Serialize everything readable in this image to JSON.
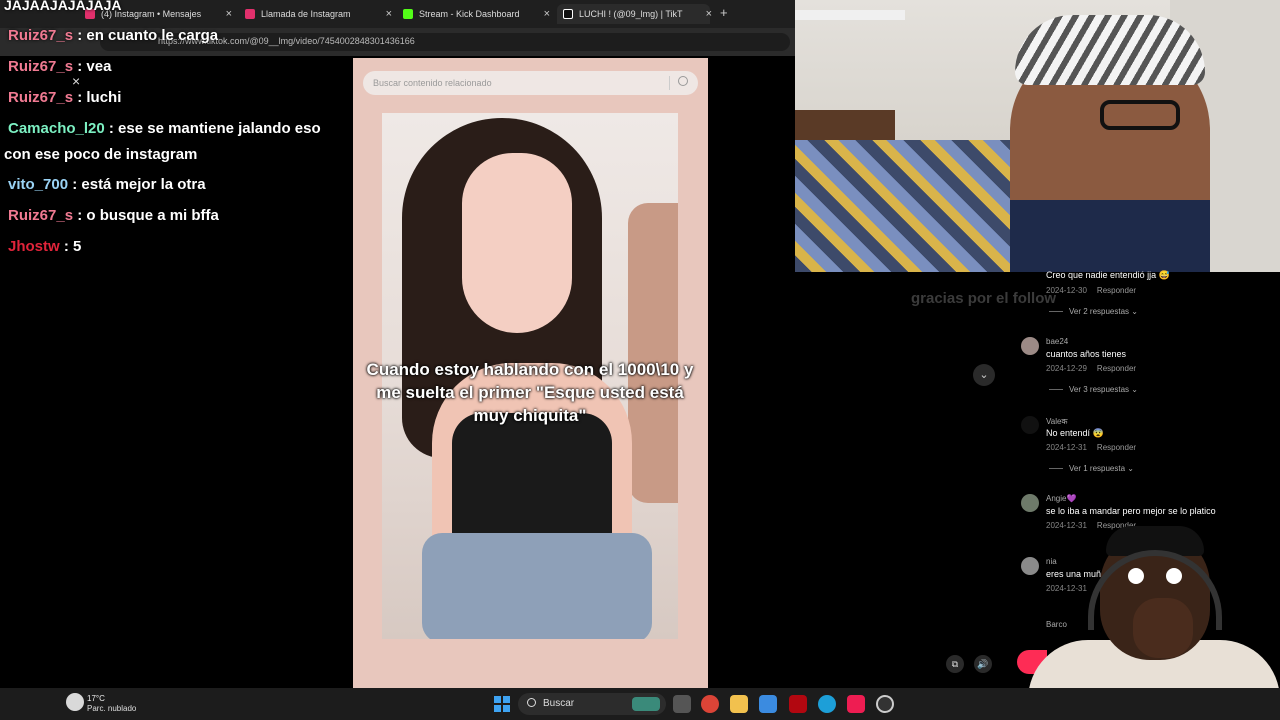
{
  "browser": {
    "tabs": [
      {
        "title": "(4) Instagram • Mensajes",
        "color": "#e1306c"
      },
      {
        "title": "Llamada de Instagram",
        "color": "#e1306c"
      },
      {
        "title": "Stream - Kick Dashboard",
        "color": "#53fc18"
      },
      {
        "title": "LUCHI ! (@09_lmg) | TikT",
        "color": "#ffffff"
      }
    ],
    "new_tab": "+",
    "url": "https://www.tiktok.com/@09__lmg/video/7454002848301436166"
  },
  "chat": {
    "top_message": "JAJAAJAJAJAJA",
    "close": "×",
    "messages": [
      {
        "user": "Ruiz67_s",
        "user_color": "#f07a92",
        "text": ": en cuanto le carga"
      },
      {
        "user": "Ruiz67_s",
        "user_color": "#f07a92",
        "text": ": vea"
      },
      {
        "user": "Ruiz67_s",
        "user_color": "#f07a92",
        "text": ": luchi"
      },
      {
        "user": "Camacho_l20",
        "user_color": "#7cf0c2",
        "text": ": ese se mantiene jalando eso con ese poco de instagram"
      },
      {
        "user": "vito_700",
        "user_color": "#9ad3f5",
        "text": ": está mejor la otra"
      },
      {
        "user": "Ruiz67_s",
        "user_color": "#f07a92",
        "text": ": o busque a mi bffa"
      },
      {
        "user": "Jhostw",
        "user_color": "#e0243a",
        "text": ": 5"
      }
    ]
  },
  "tiktok": {
    "search_placeholder": "Buscar contenido relacionado",
    "video_caption": "Cuando estoy hablando con el 1000\\10 y me suelta el primer \"Esque usted está muy chiquita\"",
    "overlay_text": "gracias por el follow",
    "comments": [
      {
        "name": "",
        "text": "Creo que nadie entendió jja 😅",
        "date": "2024-12-30",
        "reply": "Responder",
        "more": "Ver 2 respuestas"
      },
      {
        "name": "bae24",
        "text": "cuantos años tienes",
        "date": "2024-12-29",
        "reply": "Responder",
        "more": "Ver 3 respuestas"
      },
      {
        "name": "Valeक",
        "text": "No entendí 😨",
        "date": "2024-12-31",
        "reply": "Responder",
        "more": "Ver 1 respuesta"
      },
      {
        "name": "Angie💜",
        "text": "se lo iba a mandar pero mejor se lo platico",
        "date": "2024-12-31",
        "reply": "Responder",
        "more": ""
      },
      {
        "name": "nia",
        "text": "eres una muñ",
        "date": "2024-12-31",
        "reply": "R",
        "more": ""
      },
      {
        "name": "Barco",
        "text": "",
        "date": "",
        "reply": "",
        "more": ""
      }
    ]
  },
  "taskbar": {
    "temp": "17°C",
    "weather": "Parc. nublado",
    "search_label": "Buscar"
  }
}
